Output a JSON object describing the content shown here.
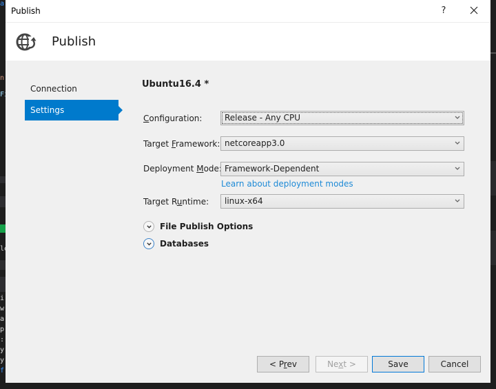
{
  "dialog": {
    "window_title": "Publish",
    "header_title": "Publish",
    "header_icon": "globe-publish-icon",
    "help_glyph": "?",
    "close_icon": "close-icon"
  },
  "nav": {
    "items": [
      {
        "label": "Connection",
        "active": false
      },
      {
        "label": "Settings",
        "active": true
      }
    ]
  },
  "settings": {
    "profile_name": "Ubuntu16.4 *",
    "fields": [
      {
        "label_pre": "",
        "label_key": "C",
        "label_post": "onfiguration:",
        "value": "Release - Any CPU"
      },
      {
        "label_pre": "Target ",
        "label_key": "F",
        "label_post": "ramework:",
        "value": "netcoreapp3.0"
      },
      {
        "label_pre": "Deployment ",
        "label_key": "M",
        "label_post": "ode:",
        "value": "Framework-Dependent"
      },
      {
        "label_pre": "Target R",
        "label_key": "u",
        "label_post": "ntime:",
        "value": "linux-x64"
      }
    ],
    "deployment_link": "Learn about deployment modes",
    "sections": [
      {
        "label": "File Publish Options",
        "icon": "chevron-down-circle-icon"
      },
      {
        "label": "Databases",
        "icon": "chevron-down-circle-icon"
      }
    ]
  },
  "footer": {
    "prev": {
      "pre": "< P",
      "key": "r",
      "post": "ev",
      "enabled": true
    },
    "next": {
      "pre": "Ne",
      "key": "x",
      "post": "t >",
      "enabled": false
    },
    "save": {
      "label": "Save",
      "enabled": true
    },
    "cancel": {
      "label": "Cancel",
      "enabled": true
    }
  },
  "background": {
    "snippets": [
      "a",
      "n",
      "Fi",
      "le",
      "i",
      "w",
      "a",
      "p",
      ":",
      "y",
      "y",
      "f"
    ],
    "accent_colors": {
      "selection": "#007acc",
      "link": "#1e8ad6",
      "status_green": "#16a14a"
    }
  }
}
